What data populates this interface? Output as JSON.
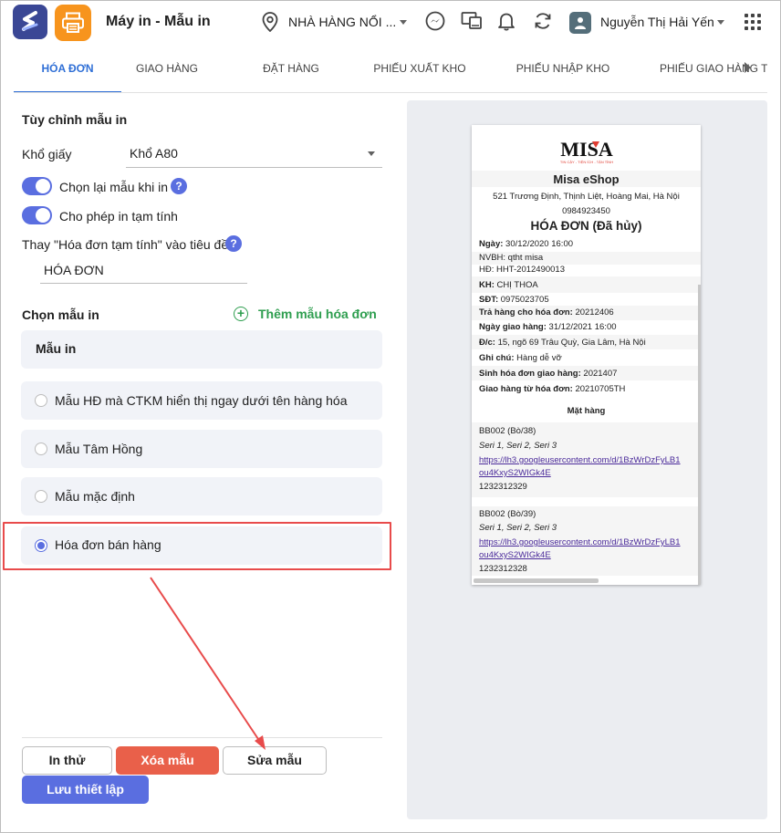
{
  "header": {
    "title": "Máy in - Mẫu in",
    "location": "NHÀ HÀNG NỔI ...",
    "user": "Nguyễn Thị Hải Yến"
  },
  "tabs": [
    {
      "label": "HÓA ĐƠN",
      "active": true
    },
    {
      "label": "GIAO HÀNG"
    },
    {
      "label": "ĐẶT HÀNG"
    },
    {
      "label": "PHIẾU XUẤT KHO"
    },
    {
      "label": "PHIẾU NHẬP KHO"
    },
    {
      "label": "PHIẾU GIAO HÀNG TR"
    }
  ],
  "settings": {
    "title": "Tùy chỉnh mẫu in",
    "paper_label": "Khổ giấy",
    "paper_value": "Khổ A80",
    "toggle1_label": "Chọn lại mẫu khi in",
    "toggle2_label": "Cho phép in tạm tính",
    "rename_label": "Thay \"Hóa đơn tạm tính\" vào tiêu đề",
    "rename_value": "HÓA ĐƠN",
    "help": "?"
  },
  "templates": {
    "title": "Chọn mẫu in",
    "add_label": "Thêm mẫu hóa đơn",
    "add_symbol": "+",
    "header": "Mẫu in",
    "items": [
      {
        "label": "Mẫu HĐ mà CTKM hiển thị ngay dưới tên hàng hóa",
        "selected": false
      },
      {
        "label": "Mẫu Tâm Hồng",
        "selected": false
      },
      {
        "label": "Mẫu mặc định",
        "selected": false
      },
      {
        "label": "Hóa đơn bán hàng",
        "selected": true
      }
    ]
  },
  "actions": {
    "test": "In thử",
    "delete": "Xóa mẫu",
    "edit": "Sửa mẫu",
    "save": "Lưu thiết lập"
  },
  "receipt": {
    "logo": "MISA",
    "tagline": "TIN CẬY - TIỆN ÍCH - TẬN TÌNH",
    "shop": "Misa eShop",
    "address": "521 Trương Định, Thịnh Liệt, Hoàng Mai, Hà Nội",
    "phone": "0984923450",
    "title": "HÓA ĐƠN (Đã hủy)",
    "date_label": "Ngày:",
    "date": "30/12/2020 16:00",
    "staff": "NVBH: qtht misa",
    "code": "HĐ: HHT-2012490013",
    "customer_label": "KH:",
    "customer": "CHỊ THOA",
    "phone_label": "SĐT:",
    "customer_phone": "0975023705",
    "return_label": "Trả hàng cho hóa đơn:",
    "return": "20212406",
    "delivery_date_label": "Ngày giao hàng:",
    "delivery_date": "31/12/2021 16:00",
    "addr_label": "Đ/c:",
    "addr": "15, ngõ 69 Trâu Quỳ, Gia Lâm, Hà Nội",
    "note_label": "Ghi chú:",
    "note": "Hàng dễ vỡ",
    "gen_label": "Sinh hóa đơn giao hàng:",
    "gen": "2021407",
    "from_label": "Giao hàng từ hóa đơn:",
    "from": "20210705TH",
    "items_title": "Mặt hàng",
    "items": [
      {
        "code": "BB002 (Bò/38)",
        "serial": "Seri 1, Seri 2, Seri 3",
        "link1": "https://lh3.googleusercontent.com/d/1BzWrDzFyLB1",
        "link2": "ou4KxyS2WIGk4E",
        "barcode": "1232312329"
      },
      {
        "code": "BB002 (Bò/39)",
        "serial": "Seri 1, Seri 2, Seri 3",
        "link1": "https://lh3.googleusercontent.com/d/1BzWrDzFyLB1",
        "link2": "ou4KxyS2WIGk4E",
        "barcode": "1232312328"
      }
    ]
  },
  "colors": {
    "accent": "#5a6ee0",
    "tab_active": "#2f6fd6",
    "danger": "#e9604a",
    "add": "#2e9e4f",
    "annotation": "#e84b4b"
  }
}
